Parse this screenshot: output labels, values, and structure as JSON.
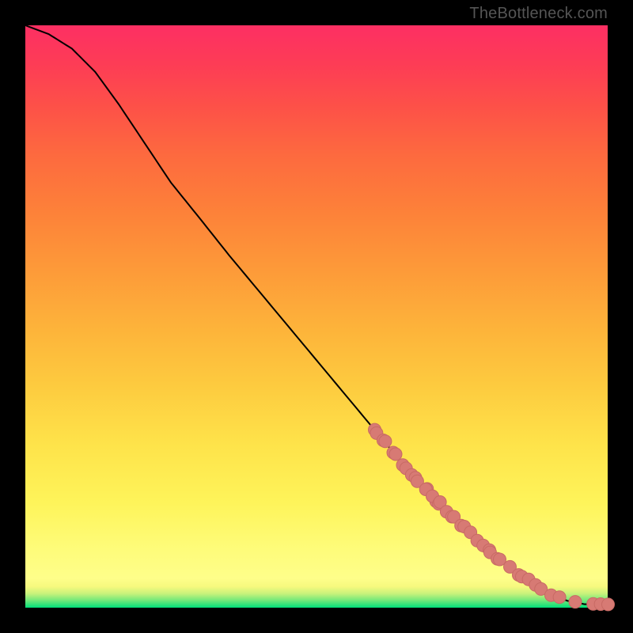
{
  "attribution": "TheBottleneck.com",
  "colors": {
    "curve": "#000000",
    "point_fill": "#d77a74",
    "point_stroke": "#c86a64"
  },
  "chart_data": {
    "type": "line",
    "title": "",
    "xlabel": "",
    "ylabel": "",
    "xlim": [
      0,
      100
    ],
    "ylim": [
      0,
      100
    ],
    "curve": [
      {
        "x": 0,
        "y": 100
      },
      {
        "x": 4,
        "y": 98.5
      },
      {
        "x": 8,
        "y": 96
      },
      {
        "x": 12,
        "y": 92
      },
      {
        "x": 16,
        "y": 86.5
      },
      {
        "x": 20,
        "y": 80.5
      },
      {
        "x": 25,
        "y": 73
      },
      {
        "x": 30,
        "y": 66.8
      },
      {
        "x": 35,
        "y": 60.5
      },
      {
        "x": 40,
        "y": 54.5
      },
      {
        "x": 45,
        "y": 48.5
      },
      {
        "x": 50,
        "y": 42.5
      },
      {
        "x": 55,
        "y": 36.5
      },
      {
        "x": 60,
        "y": 30.5
      },
      {
        "x": 65,
        "y": 24.5
      },
      {
        "x": 70,
        "y": 19
      },
      {
        "x": 75,
        "y": 14
      },
      {
        "x": 80,
        "y": 9.5
      },
      {
        "x": 85,
        "y": 5.5
      },
      {
        "x": 90,
        "y": 2.5
      },
      {
        "x": 93,
        "y": 1.2
      },
      {
        "x": 96,
        "y": 0.6
      },
      {
        "x": 98,
        "y": 0.6
      },
      {
        "x": 100,
        "y": 0.6
      }
    ],
    "point_clusters": [
      {
        "along": [
          60,
          70
        ],
        "count": 14,
        "jitter": 0.6,
        "r": 8
      },
      {
        "along": [
          70,
          74
        ],
        "count": 6,
        "jitter": 0.7,
        "r": 8
      },
      {
        "along": [
          75,
          82
        ],
        "count": 9,
        "jitter": 0.6,
        "r": 8
      },
      {
        "along": [
          83,
          90
        ],
        "count": 7,
        "jitter": 0.6,
        "r": 8
      },
      {
        "along": [
          92,
          94
        ],
        "count": 2,
        "jitter": 0.2,
        "r": 8
      },
      {
        "along": [
          97,
          100
        ],
        "count": 3,
        "jitter": 0.1,
        "r": 8
      }
    ]
  }
}
